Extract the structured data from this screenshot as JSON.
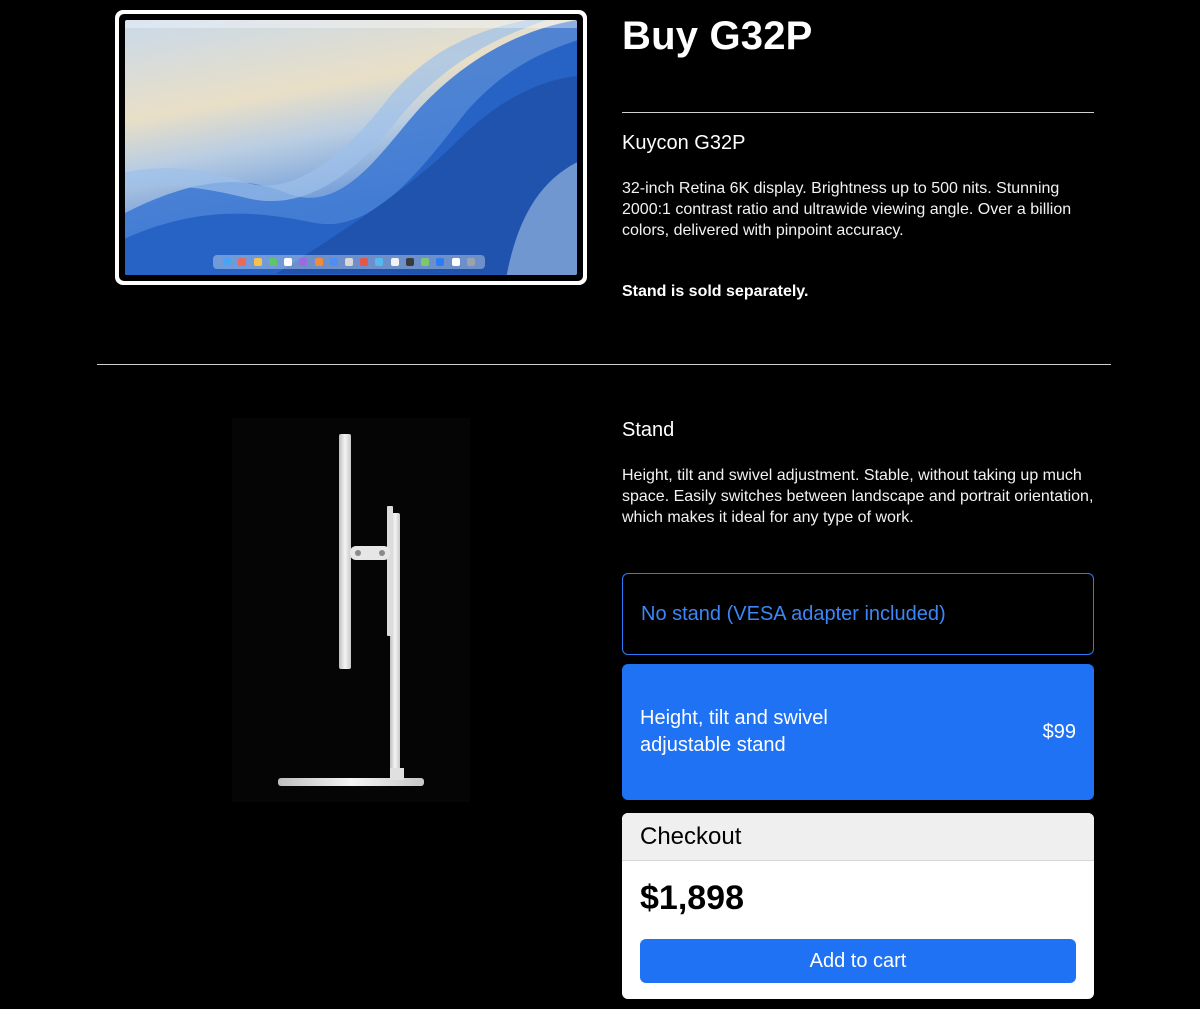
{
  "header": {
    "title": "Buy G32P"
  },
  "product": {
    "name": "Kuycon G32P",
    "description": "32-inch Retina 6K display. Brightness up to 500 nits. Stunning 2000:1 contrast ratio and ultrawide viewing angle. Over a billion colors, delivered with pinpoint accuracy.",
    "note": "Stand is sold separately."
  },
  "stand": {
    "heading": "Stand",
    "description": "Height, tilt and swivel adjustment. Stable, without taking up much space. Easily switches between landscape and portrait orientation, which makes it ideal for any type of work.",
    "options": [
      {
        "label": "No stand (VESA adapter included)",
        "price": "",
        "selected": false
      },
      {
        "label": "Height, tilt and swivel adjustable stand",
        "price": "$99",
        "selected": true
      }
    ]
  },
  "checkout": {
    "title": "Checkout",
    "total": "$1,898",
    "button_label": "Add to cart"
  },
  "colors": {
    "accent": "#1f72f4",
    "background": "#000000"
  },
  "icons": {
    "monitor_image": "monitor-product-image",
    "stand_image": "stand-product-image"
  }
}
